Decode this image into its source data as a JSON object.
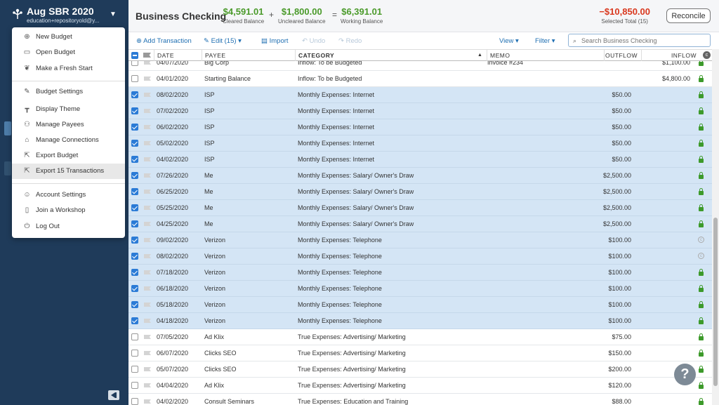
{
  "sidebar": {
    "budget_name": "Aug SBR 2020",
    "budget_email": "education+repositoryold@y..."
  },
  "menu": {
    "items": [
      {
        "label": "New Budget",
        "icon": "plus-circle-icon"
      },
      {
        "label": "Open Budget",
        "icon": "folder-icon"
      },
      {
        "label": "Make a Fresh Start",
        "icon": "leaf-icon"
      },
      {
        "label": "Budget Settings",
        "icon": "wrench-icon"
      },
      {
        "label": "Display Theme",
        "icon": "paint-roller-icon"
      },
      {
        "label": "Manage Payees",
        "icon": "people-icon"
      },
      {
        "label": "Manage Connections",
        "icon": "bank-icon"
      },
      {
        "label": "Export Budget",
        "icon": "export-icon"
      },
      {
        "label": "Export 15 Transactions",
        "icon": "export-icon"
      },
      {
        "label": "Account Settings",
        "icon": "user-icon"
      },
      {
        "label": "Join a Workshop",
        "icon": "book-icon"
      },
      {
        "label": "Log Out",
        "icon": "power-icon"
      }
    ]
  },
  "header": {
    "account_title": "Business Checking",
    "cleared_amount": "$4,591.01",
    "cleared_label": "Cleared Balance",
    "plus": "+",
    "uncleared_amount": "$1,800.00",
    "uncleared_label": "Uncleared Balance",
    "equals": "=",
    "working_amount": "$6,391.01",
    "working_label": "Working Balance",
    "selected_amount": "−$10,850.00",
    "selected_label": "Selected Total (15)",
    "reconcile_label": "Reconcile"
  },
  "toolbar": {
    "add_transaction": "Add Transaction",
    "edit": "Edit (15)",
    "import": "Import",
    "undo": "Undo",
    "redo": "Redo",
    "view": "View",
    "filter": "Filter",
    "search_placeholder": "Search Business Checking"
  },
  "table": {
    "columns": {
      "date": "DATE",
      "payee": "PAYEE",
      "category": "CATEGORY",
      "memo": "MEMO",
      "outflow": "OUTFLOW",
      "inflow": "INFLOW"
    },
    "rows": [
      {
        "selected": false,
        "date": "04/07/2020",
        "payee": "Big Corp",
        "category": "Inflow: To be Budgeted",
        "memo": "Invoice #234",
        "outflow": "",
        "inflow": "$1,100.00",
        "status": "lock"
      },
      {
        "selected": false,
        "date": "04/01/2020",
        "payee": "Starting Balance",
        "category": "Inflow: To be Budgeted",
        "memo": "",
        "outflow": "",
        "inflow": "$4,800.00",
        "status": "lock"
      },
      {
        "selected": true,
        "date": "08/02/2020",
        "payee": "ISP",
        "category": "Monthly Expenses: Internet",
        "memo": "",
        "outflow": "$50.00",
        "inflow": "",
        "status": "lock"
      },
      {
        "selected": true,
        "date": "07/02/2020",
        "payee": "ISP",
        "category": "Monthly Expenses: Internet",
        "memo": "",
        "outflow": "$50.00",
        "inflow": "",
        "status": "lock"
      },
      {
        "selected": true,
        "date": "06/02/2020",
        "payee": "ISP",
        "category": "Monthly Expenses: Internet",
        "memo": "",
        "outflow": "$50.00",
        "inflow": "",
        "status": "lock"
      },
      {
        "selected": true,
        "date": "05/02/2020",
        "payee": "ISP",
        "category": "Monthly Expenses: Internet",
        "memo": "",
        "outflow": "$50.00",
        "inflow": "",
        "status": "lock"
      },
      {
        "selected": true,
        "date": "04/02/2020",
        "payee": "ISP",
        "category": "Monthly Expenses: Internet",
        "memo": "",
        "outflow": "$50.00",
        "inflow": "",
        "status": "lock"
      },
      {
        "selected": true,
        "date": "07/26/2020",
        "payee": "Me",
        "category": "Monthly Expenses: Salary/ Owner's Draw",
        "memo": "",
        "outflow": "$2,500.00",
        "inflow": "",
        "status": "lock"
      },
      {
        "selected": true,
        "date": "06/25/2020",
        "payee": "Me",
        "category": "Monthly Expenses: Salary/ Owner's Draw",
        "memo": "",
        "outflow": "$2,500.00",
        "inflow": "",
        "status": "lock"
      },
      {
        "selected": true,
        "date": "05/25/2020",
        "payee": "Me",
        "category": "Monthly Expenses: Salary/ Owner's Draw",
        "memo": "",
        "outflow": "$2,500.00",
        "inflow": "",
        "status": "lock"
      },
      {
        "selected": true,
        "date": "04/25/2020",
        "payee": "Me",
        "category": "Monthly Expenses: Salary/ Owner's Draw",
        "memo": "",
        "outflow": "$2,500.00",
        "inflow": "",
        "status": "lock"
      },
      {
        "selected": true,
        "date": "09/02/2020",
        "payee": "Verizon",
        "category": "Monthly Expenses: Telephone",
        "memo": "",
        "outflow": "$100.00",
        "inflow": "",
        "status": "cleared"
      },
      {
        "selected": true,
        "date": "08/02/2020",
        "payee": "Verizon",
        "category": "Monthly Expenses: Telephone",
        "memo": "",
        "outflow": "$100.00",
        "inflow": "",
        "status": "cleared"
      },
      {
        "selected": true,
        "date": "07/18/2020",
        "payee": "Verizon",
        "category": "Monthly Expenses: Telephone",
        "memo": "",
        "outflow": "$100.00",
        "inflow": "",
        "status": "lock"
      },
      {
        "selected": true,
        "date": "06/18/2020",
        "payee": "Verizon",
        "category": "Monthly Expenses: Telephone",
        "memo": "",
        "outflow": "$100.00",
        "inflow": "",
        "status": "lock"
      },
      {
        "selected": true,
        "date": "05/18/2020",
        "payee": "Verizon",
        "category": "Monthly Expenses: Telephone",
        "memo": "",
        "outflow": "$100.00",
        "inflow": "",
        "status": "lock"
      },
      {
        "selected": true,
        "date": "04/18/2020",
        "payee": "Verizon",
        "category": "Monthly Expenses: Telephone",
        "memo": "",
        "outflow": "$100.00",
        "inflow": "",
        "status": "lock"
      },
      {
        "selected": false,
        "date": "07/05/2020",
        "payee": "Ad Klix",
        "category": "True Expenses: Advertising/ Marketing",
        "memo": "",
        "outflow": "$75.00",
        "inflow": "",
        "status": "lock"
      },
      {
        "selected": false,
        "date": "06/07/2020",
        "payee": "Clicks SEO",
        "category": "True Expenses: Advertising/ Marketing",
        "memo": "",
        "outflow": "$150.00",
        "inflow": "",
        "status": "lock"
      },
      {
        "selected": false,
        "date": "05/07/2020",
        "payee": "Clicks SEO",
        "category": "True Expenses: Advertising/ Marketing",
        "memo": "",
        "outflow": "$200.00",
        "inflow": "",
        "status": "lock"
      },
      {
        "selected": false,
        "date": "04/04/2020",
        "payee": "Ad Klix",
        "category": "True Expenses: Advertising/ Marketing",
        "memo": "",
        "outflow": "$120.00",
        "inflow": "",
        "status": "lock"
      },
      {
        "selected": false,
        "date": "04/02/2020",
        "payee": "Consult Seminars",
        "category": "True Expenses: Education and Training",
        "memo": "",
        "outflow": "$88.00",
        "inflow": "",
        "status": "lock"
      }
    ]
  },
  "help": {
    "label": "?"
  }
}
